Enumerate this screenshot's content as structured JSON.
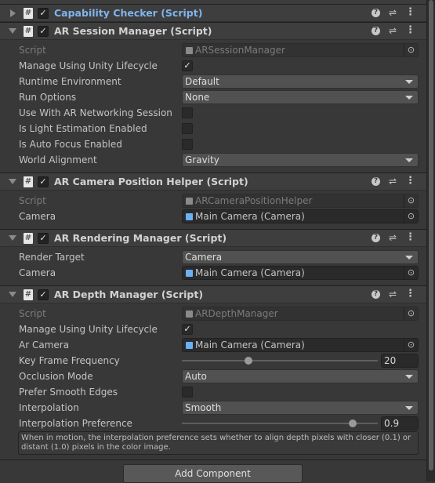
{
  "components": [
    {
      "title": "Capability Checker (Script)",
      "expanded": false,
      "enabled": true,
      "highlighted": true,
      "fields": []
    },
    {
      "title": "AR Session Manager (Script)",
      "expanded": true,
      "enabled": true,
      "fields": [
        {
          "label": "Script",
          "type": "script",
          "value": "ARSessionManager"
        },
        {
          "label": "Manage Using Unity Lifecycle",
          "type": "check",
          "checked": true
        },
        {
          "label": "Runtime Environment",
          "type": "dropdown",
          "value": "Default"
        },
        {
          "label": "Run Options",
          "type": "dropdown",
          "value": "None"
        },
        {
          "label": "Use With AR Networking Session",
          "type": "check",
          "checked": false
        },
        {
          "label": "Is Light Estimation Enabled",
          "type": "check",
          "checked": false
        },
        {
          "label": "Is Auto Focus Enabled",
          "type": "check",
          "checked": false
        },
        {
          "label": "World Alignment",
          "type": "dropdown",
          "value": "Gravity"
        }
      ]
    },
    {
      "title": "AR Camera Position Helper (Script)",
      "expanded": true,
      "enabled": true,
      "fields": [
        {
          "label": "Script",
          "type": "script",
          "value": "ARCameraPositionHelper"
        },
        {
          "label": "Camera",
          "type": "object",
          "value": "Main Camera (Camera)",
          "icon": "camera-icon"
        }
      ]
    },
    {
      "title": "AR Rendering Manager (Script)",
      "expanded": true,
      "enabled": true,
      "fields": [
        {
          "label": "Render Target",
          "type": "dropdown",
          "value": "Camera"
        },
        {
          "label": "Camera",
          "type": "object",
          "value": "Main Camera (Camera)",
          "icon": "camera-icon"
        }
      ]
    },
    {
      "title": "AR Depth Manager (Script)",
      "expanded": true,
      "enabled": true,
      "fields": [
        {
          "label": "Script",
          "type": "script",
          "value": "ARDepthManager"
        },
        {
          "label": "Manage Using Unity Lifecycle",
          "type": "check",
          "checked": true
        },
        {
          "label": "Ar Camera",
          "type": "object",
          "value": "Main Camera (Camera)",
          "icon": "camera-icon"
        },
        {
          "label": "Key Frame Frequency",
          "type": "slider",
          "value": "20",
          "fraction": 0.34
        },
        {
          "label": "Occlusion Mode",
          "type": "dropdown",
          "value": "Auto"
        },
        {
          "label": "Prefer Smooth Edges",
          "type": "check",
          "checked": false
        },
        {
          "label": "Interpolation",
          "type": "dropdown",
          "value": "Smooth"
        },
        {
          "label": "Interpolation Preference",
          "type": "slider",
          "value": "0.9",
          "fraction": 0.87
        },
        {
          "type": "help",
          "value": "When in motion, the interpolation preference sets whether to align depth pixels with closer (0.1) or distant (1.0) pixels in the color image."
        }
      ]
    }
  ],
  "icons": {
    "help": "?",
    "preset": "⇌",
    "menu": "⋮",
    "checkmark": "✓",
    "script": "#",
    "picker": "⊙"
  },
  "add_component_label": "Add Component",
  "colors": {
    "link": "#7fb4ee",
    "background": "#383838"
  }
}
